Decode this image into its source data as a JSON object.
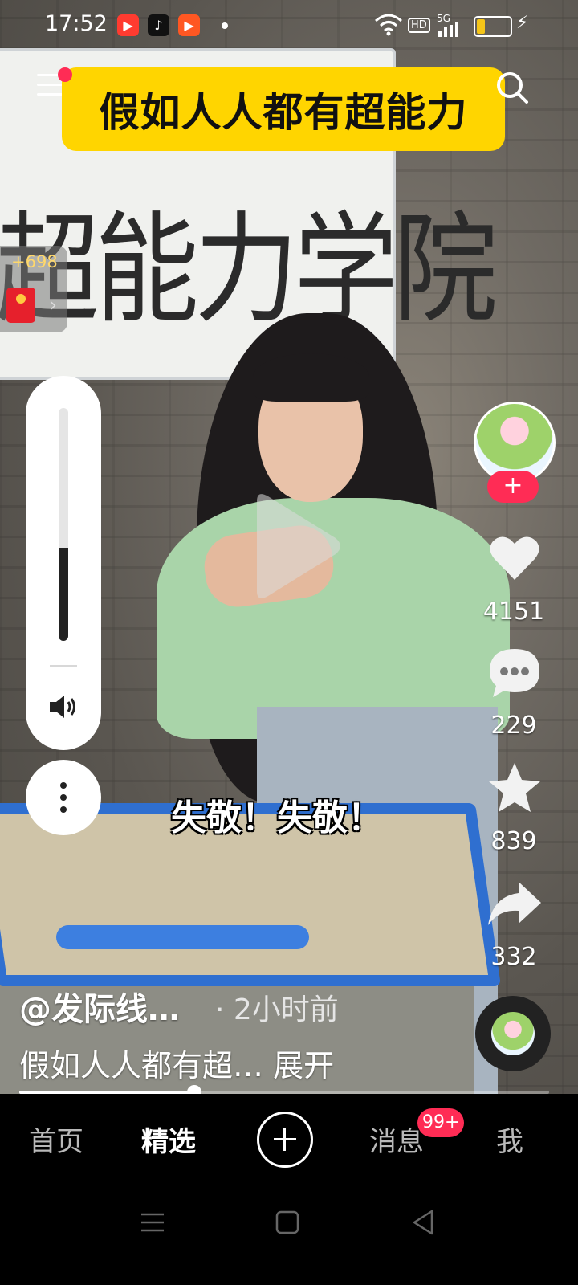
{
  "status_bar": {
    "time": "17:52",
    "app_icons": [
      "youtube-like-icon",
      "tiktok-icon",
      "video-icon"
    ],
    "network": "5G",
    "hd_label": "HD",
    "battery_level": 0.25,
    "charging": true
  },
  "top": {
    "title": "假如人人都有超能力",
    "whiteboard_text": "超能力学院"
  },
  "red_packet": {
    "count": "+698"
  },
  "volume": {
    "level": 0.4
  },
  "video": {
    "subtitle": "失敬！失敬！"
  },
  "actions": {
    "likes": "4151",
    "comments": "229",
    "favorites": "839",
    "shares": "332",
    "follow_symbol": "+"
  },
  "info": {
    "author": "@发际线…",
    "separator": "·",
    "time_ago": "2小时前",
    "caption": "假如人人都有超… 展开"
  },
  "progress": {
    "fraction": 0.33
  },
  "nav": {
    "home": "首页",
    "featured": "精选",
    "messages": "消息",
    "messages_badge": "99+",
    "me": "我"
  },
  "colors": {
    "title_banner": "#ffd500",
    "accent": "#ff2c55",
    "desk": "#2f6fd0"
  }
}
